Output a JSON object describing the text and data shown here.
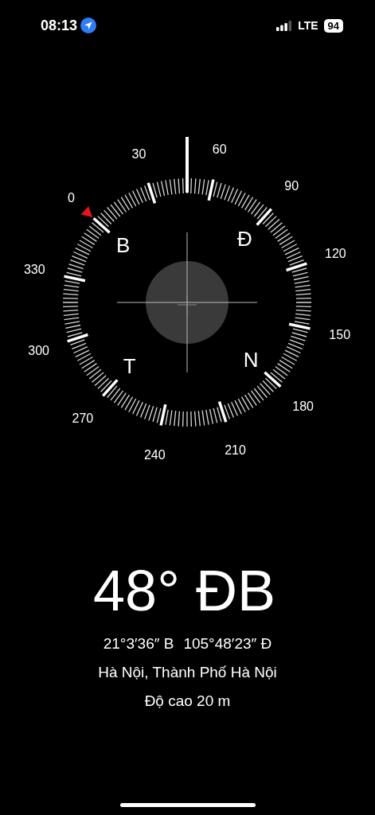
{
  "status_bar": {
    "time": "08:13",
    "network": "LTE",
    "battery": "94"
  },
  "compass": {
    "degree_labels": [
      "0",
      "30",
      "60",
      "90",
      "120",
      "150",
      "180",
      "210",
      "240",
      "270",
      "300",
      "330"
    ],
    "cardinals": [
      "B",
      "Đ",
      "T",
      "N"
    ]
  },
  "heading": "48° ĐB",
  "coordinates": {
    "latitude": "21°3′36″ B",
    "longitude": "105°48′23″ Đ"
  },
  "location": "Hà Nội, Thành Phố Hà Nội",
  "altitude": "Độ cao 20 m"
}
